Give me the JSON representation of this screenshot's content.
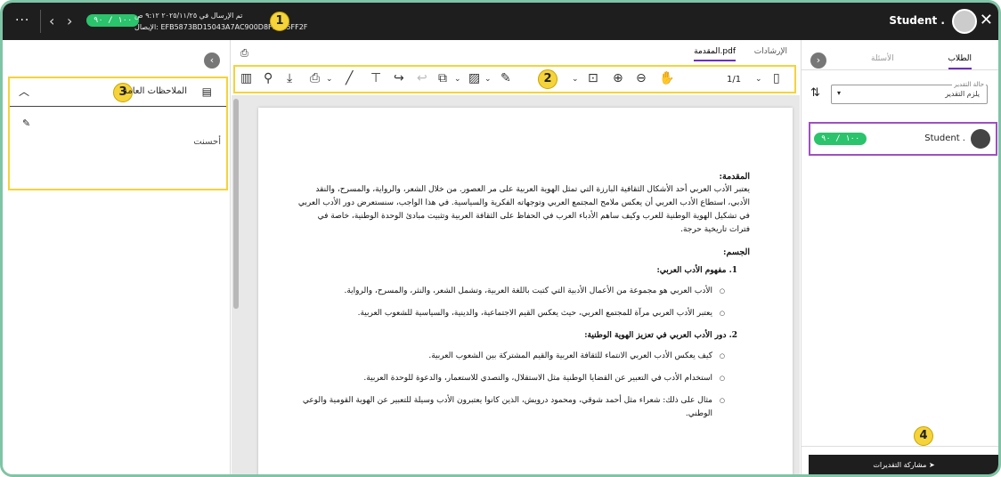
{
  "topbar": {
    "score": "١٠٠ / ٩٠",
    "submitted": "تم الإرسال في ٢٠٢٥/١١/٢٥ ٩:١٢ ص",
    "receipt": "الإيصال: EFB5873BD15043A7AC900D8F1C15FF2F",
    "student": "Student .",
    "dots": "···",
    "nav_prev": "‹",
    "nav_next": "›",
    "close": "✕",
    "badge": "1"
  },
  "left": {
    "badge": "3",
    "notes_title": "الملاحظات العامة",
    "note_text": "أحسنت"
  },
  "center": {
    "tabs": [
      "الإرشادات",
      "المقدمة.pdf"
    ],
    "badge": "2",
    "pager": "1/1"
  },
  "document": {
    "intro_heading": "المقدمة:",
    "intro_text": "يعتبر الأدب العربي أحد الأشكال الثقافية البارزة التي تمثل الهوية العربية على مر العصور. من خلال الشعر، والرواية، والمسرح، والنقد الأدبي، استطاع الأدب العربي أن يعكس ملامح المجتمع العربي وتوجهاته الفكرية والسياسية. في هذا الواجب، سنستعرض دور الأدب العربي في تشكيل الهوية الوطنية للعرب وكيف ساهم الأدباء العرب في الحفاظ على الثقافة العربية وتثبيت مبادئ الوحدة الوطنية، خاصة في فترات تاريخية حرجة.",
    "body_heading": "الجسم:",
    "section1": "1. مفهوم الأدب العربي:",
    "section1_items": [
      "الأدب العربي هو مجموعة من الأعمال الأدبية التي كتبت باللغة العربية، وتشمل الشعر، والنثر، والمسرح، والرواية.",
      "يعتبر الأدب العربي مرآة للمجتمع العربي، حيث يعكس القيم الاجتماعية، والدينية، والسياسية للشعوب العربية."
    ],
    "section2": "2. دور الأدب العربي في تعزيز الهوية الوطنية:",
    "section2_items": [
      "كيف يعكس الأدب العربي الانتماء للثقافة العربية والقيم المشتركة بين الشعوب العربية.",
      "استخدام الأدب في التعبير عن القضايا الوطنية مثل الاستقلال، والتصدي للاستعمار، والدعوة للوحدة العربية.",
      "مثال على ذلك: شعراء مثل أحمد شوقي، ومحمود درويش، الذين كانوا يعتبرون الأدب وسيلة للتعبير عن الهوية القومية والوعي الوطني."
    ]
  },
  "right": {
    "tabs": [
      "الطلاب",
      "الأسئلة"
    ],
    "filter_label": "حالة التقدير",
    "filter_value": "يلزم التقدير",
    "student_name": "Student .",
    "student_score": "١٠٠ / ٩٠",
    "share_label": "مشاركة التقديرات",
    "badge": "4"
  },
  "colors": {
    "accent": "#6b2fbf",
    "highlight": "#f5d33a",
    "success": "#2bc36b",
    "student_border": "#a04fc1"
  }
}
